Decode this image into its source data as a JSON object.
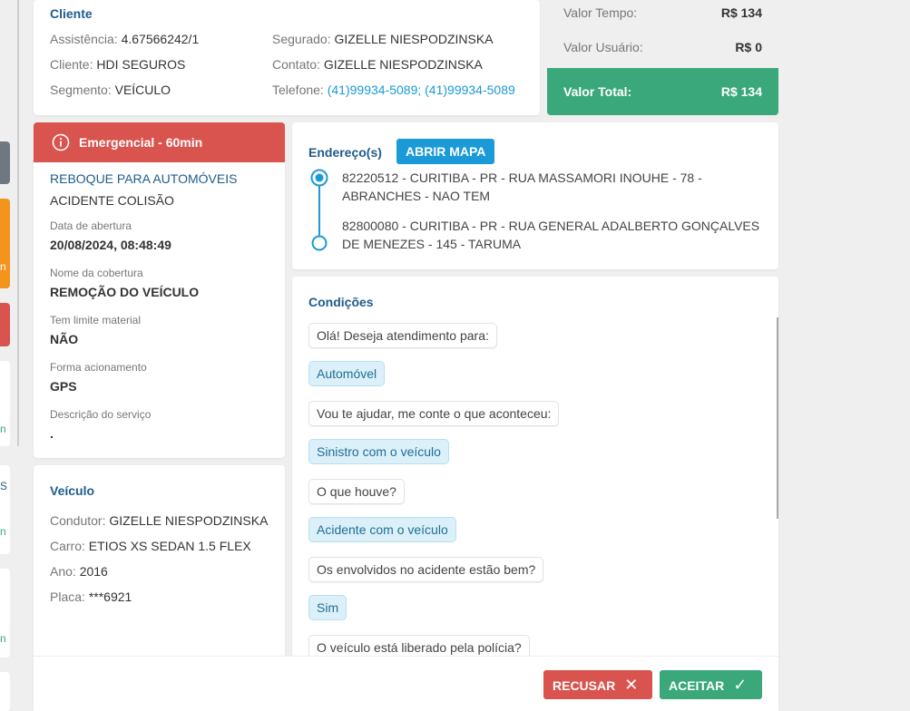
{
  "cliente": {
    "title": "Cliente",
    "assistencia_label": "Assistência:",
    "assistencia": "4.67566242/1",
    "cliente_label": "Cliente:",
    "cliente": "HDI SEGUROS",
    "segmento_label": "Segmento:",
    "segmento": "VEÍCULO",
    "segurado_label": "Segurado:",
    "segurado": "GIZELLE NIESPODZINSKA",
    "contato_label": "Contato:",
    "contato": "GIZELLE NIESPODZINSKA",
    "telefone_label": "Telefone:",
    "telefone": "(41)99934-5089; (41)99934-5089"
  },
  "valores": {
    "tempo_label": "Valor Tempo:",
    "tempo": "R$ 134",
    "usuario_label": "Valor Usuário:",
    "usuario": "R$ 0",
    "total_label": "Valor Total:",
    "total": "R$ 134"
  },
  "servico": {
    "badge": "Emergencial - 60min",
    "tipo": "REBOQUE PARA AUTOMÓVEIS",
    "subtipo": "ACIDENTE COLISÃO",
    "abertura_label": "Data de abertura",
    "abertura": "20/08/2024, 08:48:49",
    "cobertura_label": "Nome da cobertura",
    "cobertura": "REMOÇÃO DO VEÍCULO",
    "limite_label": "Tem limite material",
    "limite": "NÃO",
    "acionamento_label": "Forma acionamento",
    "acionamento": "GPS",
    "descricao_label": "Descrição do serviço",
    "descricao": "."
  },
  "veiculo": {
    "title": "Veículo",
    "condutor_label": "Condutor:",
    "condutor": "GIZELLE NIESPODZINSKA",
    "carro_label": "Carro:",
    "carro": "ETIOS XS SEDAN 1.5 FLEX",
    "ano_label": "Ano:",
    "ano": "2016",
    "placa_label": "Placa:",
    "placa": "***6921"
  },
  "endereco": {
    "title": "Endereço(s)",
    "map_button": "ABRIR MAPA",
    "origem": "82220512 - CURITIBA - PR - RUA MASSAMORI INOUHE - 78 - ABRANCHES - NAO TEM",
    "destino": "82800080 - CURITIBA - PR - RUA GENERAL ADALBERTO GONÇALVES DE MENEZES - 145 - TARUMA"
  },
  "condicoes": {
    "title": "Condições",
    "messages": [
      "Olá! Deseja atendimento para:",
      "Automóvel",
      "Vou te ajudar, me conte o que aconteceu:",
      "Sinistro com o veículo",
      "O que houve?",
      "Acidente com o veículo",
      "Os envolvidos no acidente estão bem?",
      "Sim",
      "O veículo está liberado pela polícia?"
    ]
  },
  "footer": {
    "recusar": "RECUSAR",
    "aceitar": "ACEITAR"
  },
  "colors": {
    "brand_blue": "#1f5c8a",
    "link": "#1a9ad6",
    "danger": "#d9534f",
    "success": "#3aa87a"
  },
  "left_strip": {
    "frag_text_a": "n",
    "frag_text_b": "S"
  }
}
